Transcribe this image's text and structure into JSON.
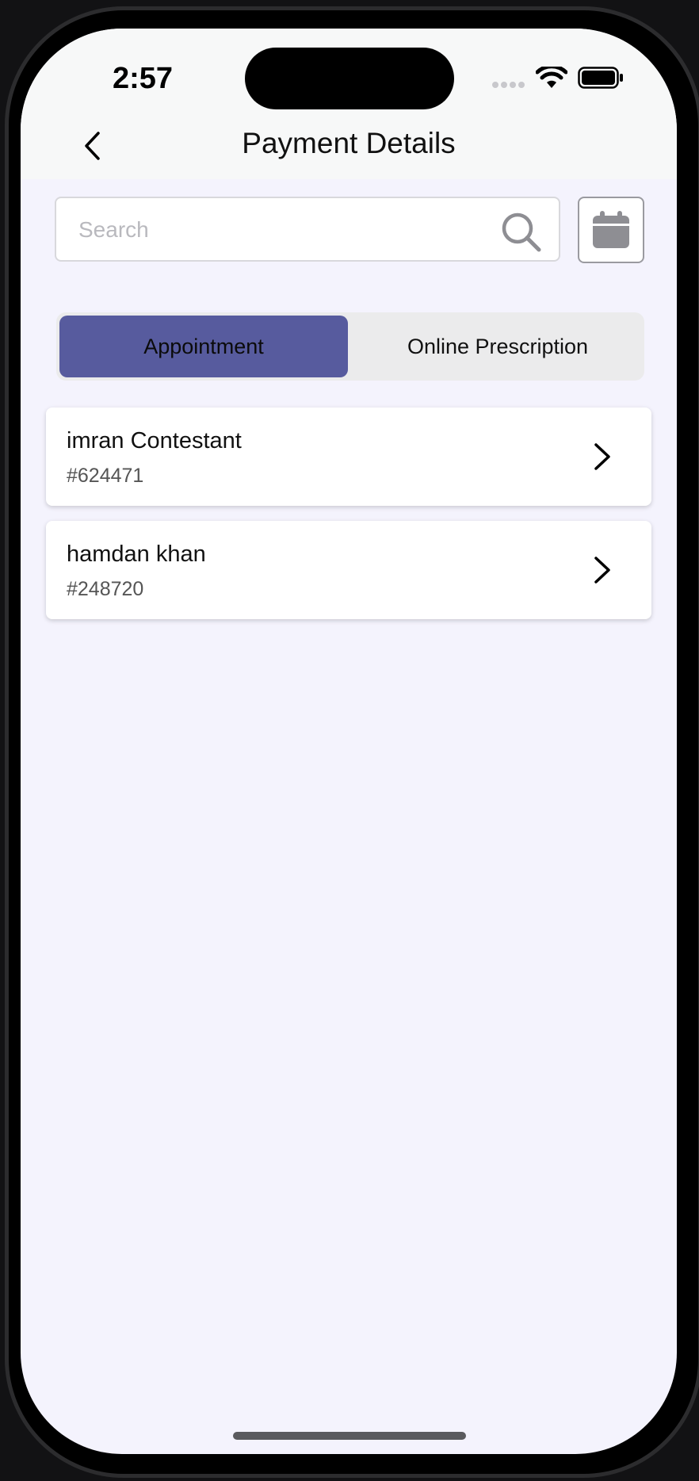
{
  "status_bar": {
    "time": "2:57",
    "icons": [
      "cellular-signal-icon",
      "wifi-icon",
      "battery-icon"
    ]
  },
  "header": {
    "title": "Payment Details",
    "back_icon": "chevron-left-icon"
  },
  "search": {
    "placeholder": "Search",
    "value": "",
    "icon": "search-icon"
  },
  "calendar_button": {
    "icon": "calendar-icon"
  },
  "tabs": [
    {
      "label": "Appointment",
      "active": true
    },
    {
      "label": "Online Prescription",
      "active": false
    }
  ],
  "payments": [
    {
      "name": "imran Contestant",
      "id": "#624471"
    },
    {
      "name": "hamdan khan",
      "id": "#248720"
    }
  ],
  "colors": {
    "accent": "#575b9e",
    "background": "#f4f3fd",
    "header_background": "#f7f8f8",
    "card_background": "#ffffff"
  }
}
